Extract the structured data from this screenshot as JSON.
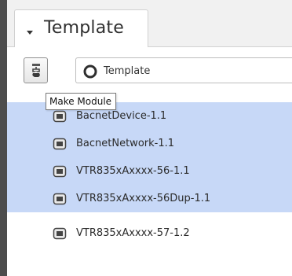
{
  "panel": {
    "title": "Template"
  },
  "toolbar": {
    "make_module_tooltip": "Make Module",
    "template_selector": "Template"
  },
  "modules": [
    {
      "label": "BacnetDevice-1.1",
      "selected": true
    },
    {
      "label": "BacnetNetwork-1.1",
      "selected": true
    },
    {
      "label": "VTR835xAxxxx-56-1.1",
      "selected": true
    },
    {
      "label": "VTR835xAxxxx-56Dup-1.1",
      "selected": true
    },
    {
      "label": "VTR835xAxxxx-57-1.2",
      "selected": false
    }
  ],
  "icons": {
    "collapse": "triangle-down-icon",
    "make_module": "make-module-icon",
    "template": "template-ring-icon",
    "module": "module-icon"
  },
  "colors": {
    "selection": "#c7d8f7",
    "left_bar": "#4d4d4d",
    "header_bg": "#f1f1f1"
  }
}
